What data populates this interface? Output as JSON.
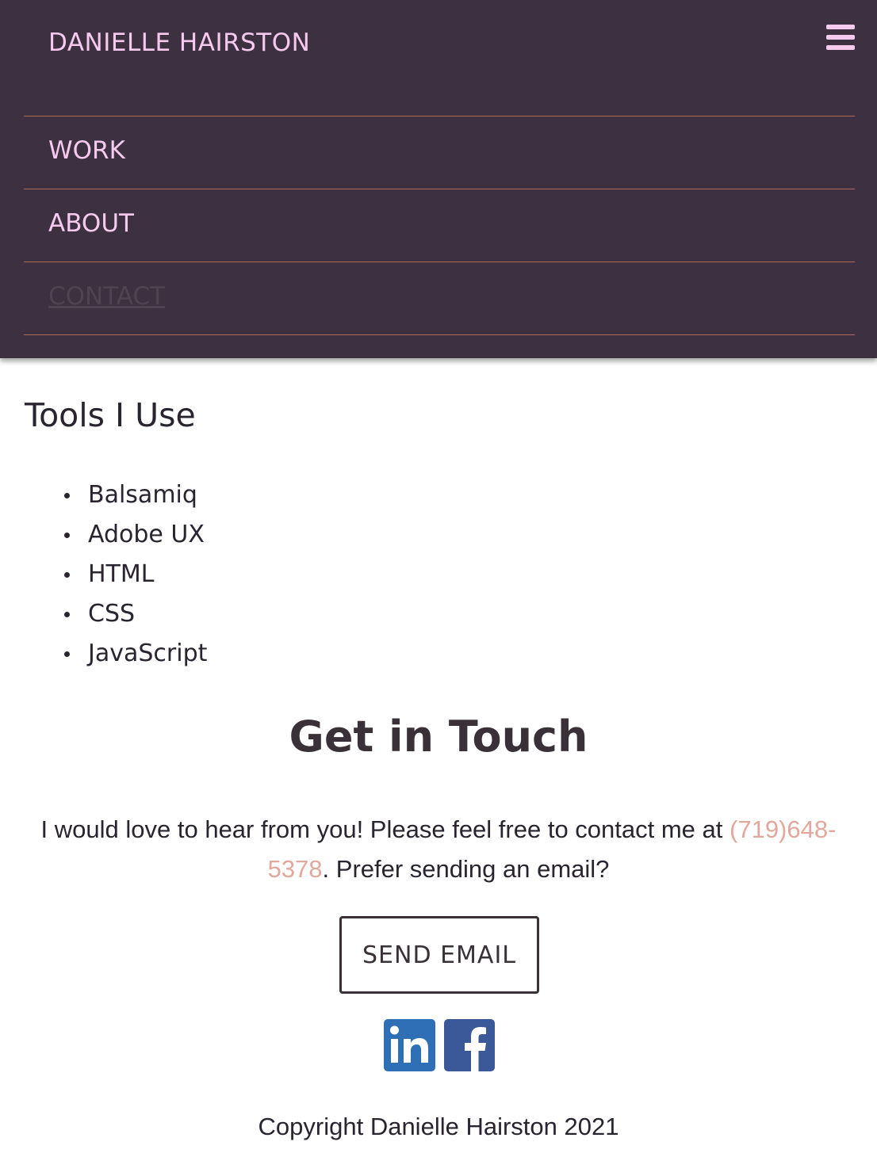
{
  "header": {
    "brand": "DANIELLE HAIRSTON",
    "menu_icon": "hamburger-menu-icon"
  },
  "nav": {
    "items": [
      {
        "label": "WORK"
      },
      {
        "label": "ABOUT"
      },
      {
        "label": "CONTACT",
        "active": true
      }
    ]
  },
  "tools": {
    "title": "Tools I Use",
    "items": [
      "Balsamiq",
      "Adobe UX",
      "HTML",
      "CSS",
      "JavaScript"
    ]
  },
  "contact": {
    "title": "Get in Touch",
    "text_before": "I would love to hear from you! Please feel free to contact me at ",
    "phone": "(719)648-5378",
    "text_after": ". Prefer sending an email?",
    "button_label": "SEND EMAIL"
  },
  "social": [
    {
      "icon": "linkedin-icon",
      "color": "#2f6fb5"
    },
    {
      "icon": "facebook-icon",
      "color": "#3b5998"
    }
  ],
  "footer": {
    "copyright": "Copyright Danielle Hairston 2021"
  },
  "colors": {
    "header_bg": "#3d3040",
    "accent_pink": "#f6c9ef",
    "divider": "#b06a58",
    "link": "#e2a89d",
    "text": "#2a2430"
  }
}
